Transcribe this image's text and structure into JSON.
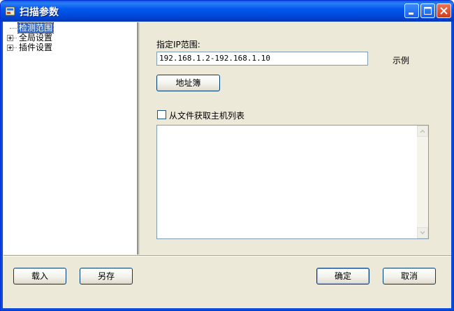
{
  "window": {
    "title": "扫描参数",
    "accent_color": "#0054e3",
    "close_color": "#e2553a"
  },
  "tree": {
    "items": [
      {
        "label": "检测范围",
        "selected": true,
        "expandable": false
      },
      {
        "label": "全局设置",
        "selected": false,
        "expandable": true
      },
      {
        "label": "插件设置",
        "selected": false,
        "expandable": true
      }
    ]
  },
  "main": {
    "ip_range_label": "指定IP范围:",
    "ip_range_value": "192.168.1.2-192.168.1.10",
    "example_label": "示例",
    "address_book_button": "地址簿",
    "from_file_label": "从文件获取主机列表",
    "from_file_checked": false,
    "host_list_value": ""
  },
  "footer": {
    "load_button": "载入",
    "save_as_button": "另存",
    "ok_button": "确定",
    "cancel_button": "取消"
  }
}
